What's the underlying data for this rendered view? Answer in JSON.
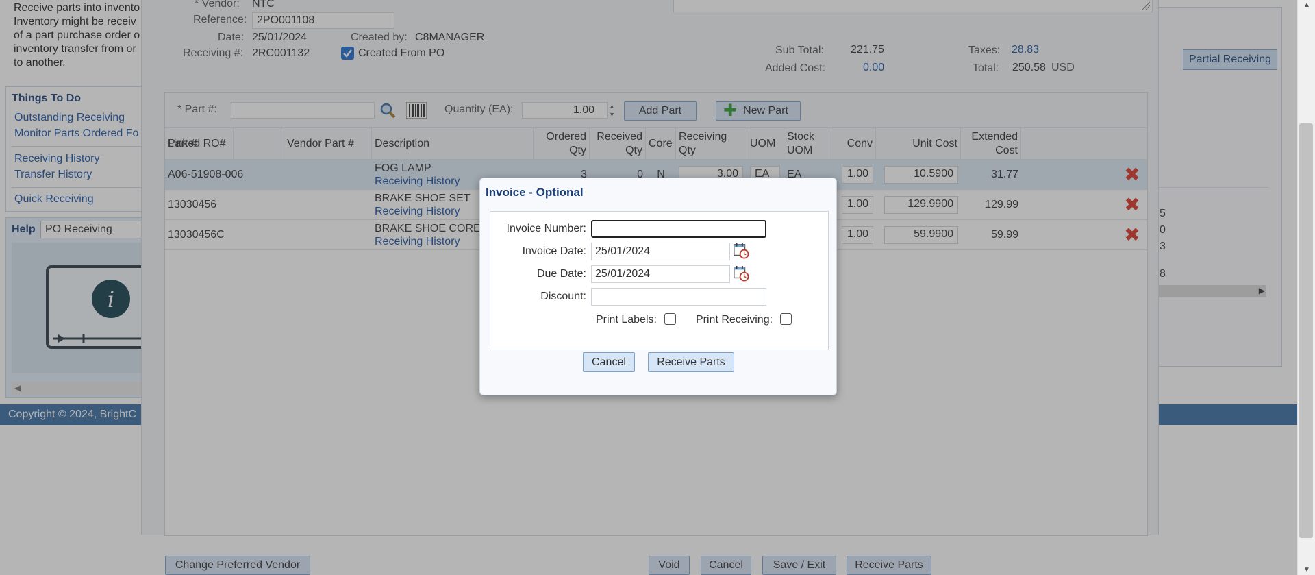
{
  "background": {
    "intro_lines": [
      "Receive parts into invento",
      "Inventory might be receiv",
      "of a part purchase order o",
      "inventory transfer from or",
      "to another."
    ],
    "todo": {
      "title": "Things To Do",
      "links": [
        "Outstanding Receiving",
        "Monitor Parts Ordered Fo",
        "Receiving History",
        "Transfer History",
        "Quick Receiving"
      ]
    },
    "help": {
      "label": "Help",
      "topic": "PO Receiving"
    },
    "copyright": "Copyright © 2024, BrightC",
    "right_panel": {
      "button": "Partial Receiving",
      "fragments": [
        "5",
        "0",
        "3",
        "8"
      ]
    }
  },
  "header": {
    "vendor_label": "* Vendor:",
    "vendor": "NTC",
    "reference_label": "Reference:",
    "reference": "2PO001108",
    "date_label": "Date:",
    "date": "25/01/2024",
    "created_by_label": "Created by:",
    "created_by": "C8MANAGER",
    "receiving_label": "Receiving #:",
    "receiving_no": "2RC001132",
    "created_from_po_label": "Created From PO",
    "subtotal_label": "Sub Total:",
    "subtotal": "221.75",
    "taxes_label": "Taxes:",
    "taxes": "28.83",
    "added_cost_label": "Added Cost:",
    "added_cost": "0.00",
    "total_label": "Total:",
    "total": "250.58",
    "currency": "USD"
  },
  "toolbar": {
    "part_label": "* Part #:",
    "quantity_label": "Quantity (EA):",
    "quantity_value": "1.00",
    "add_part": "Add Part",
    "new_part": "New Part"
  },
  "columns": {
    "part": "Part #",
    "vendor_part": "Vendor Part #",
    "description": "Description",
    "ordered_qty_1": "Ordered",
    "ordered_qty_2": "Qty",
    "received_qty_1": "Received",
    "received_qty_2": "Qty",
    "core": "Core",
    "receiving_qty": "Receiving Qty",
    "uom": "UOM",
    "stock_uom_1": "Stock",
    "stock_uom_2": "UOM",
    "conv": "Conv",
    "unit_cost": "Unit Cost",
    "extended_cost_1": "Extended",
    "extended_cost_2": "Cost",
    "linked_ro": "Linked RO#"
  },
  "rows": [
    {
      "part": "A06-51908-006",
      "description": "FOG LAMP",
      "history": "Receiving History",
      "ordered": "3",
      "received": "0",
      "core": "N",
      "receiving_qty": "3.00",
      "uom": "EA",
      "stock_uom": "EA",
      "conv": "1.00",
      "unit_cost": "10.5900",
      "extended": "31.77"
    },
    {
      "part": "13030456",
      "description": "BRAKE SHOE SET",
      "history": "Receiving History",
      "conv": "1.00",
      "unit_cost": "129.9900",
      "extended": "129.99"
    },
    {
      "part": "13030456C",
      "description": "BRAKE SHOE CORE",
      "history": "Receiving History",
      "conv": "1.00",
      "unit_cost": "59.9900",
      "extended": "59.99"
    }
  ],
  "bottom": {
    "change_vendor": "Change Preferred Vendor",
    "void": "Void",
    "cancel": "Cancel",
    "save_exit": "Save / Exit",
    "receive_parts": "Receive Parts"
  },
  "modal": {
    "title": "Invoice - Optional",
    "invoice_number_label": "Invoice Number:",
    "invoice_number": "",
    "invoice_date_label": "Invoice Date:",
    "invoice_date": "25/01/2024",
    "due_date_label": "Due Date:",
    "due_date": "25/01/2024",
    "discount_label": "Discount:",
    "discount": "",
    "print_labels_label": "Print Labels:",
    "print_receiving_label": "Print Receiving:",
    "cancel": "Cancel",
    "receive_parts": "Receive Parts"
  },
  "colors": {
    "accent": "#1b3f78",
    "link": "#1a55a8",
    "button_bg": "#d7e6f6",
    "delete": "#d9362b"
  }
}
